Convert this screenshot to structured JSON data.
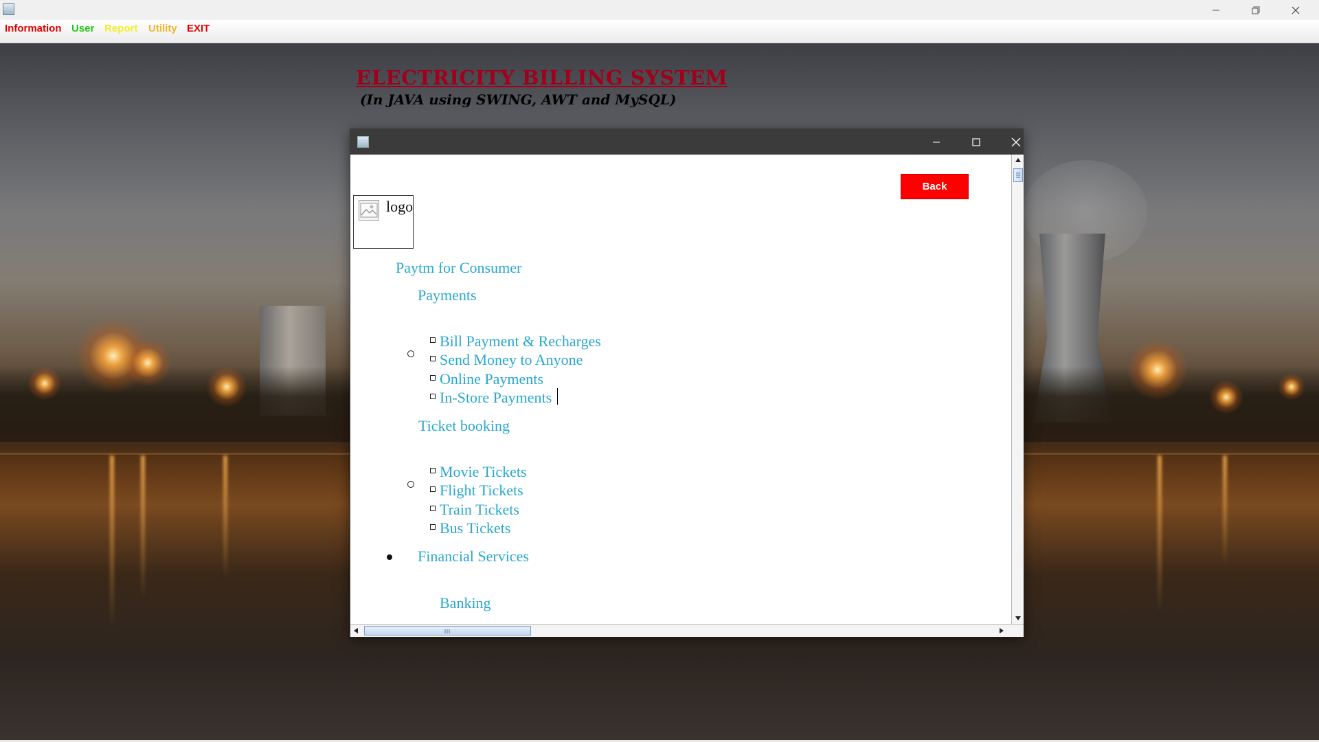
{
  "menubar": {
    "items": [
      {
        "label": "Information",
        "color": "#e00000"
      },
      {
        "label": "User",
        "color": "#22c418"
      },
      {
        "label": "Report",
        "color": "#f2ee2c"
      },
      {
        "label": "Utility",
        "color": "#f0b52a"
      },
      {
        "label": "EXIT",
        "color": "#e00000"
      }
    ]
  },
  "desktop": {
    "heading": "ELECTRICITY BILLING SYSTEM",
    "subheading": "(In JAVA using SWING, AWT and MySQL)"
  },
  "frame": {
    "back_label": "Back",
    "logo_alt": "logo",
    "content": {
      "section_title": "Paytm for Consumer",
      "payments": {
        "heading": "Payments",
        "items": [
          "Bill Payment & Recharges",
          "Send Money to Anyone",
          "Online Payments",
          "In-Store Payments"
        ]
      },
      "tickets": {
        "heading": "Ticket booking",
        "items": [
          "Movie Tickets",
          "Flight Tickets",
          "Train Tickets",
          "Bus Tickets"
        ]
      },
      "financial": {
        "heading": "Financial Services",
        "sub_heading": "Banking"
      }
    }
  },
  "colors": {
    "link_text": "#27a8cf",
    "back_button": "#ff0000",
    "heading": "#a0001c"
  },
  "icons": {
    "app": "java-cup-icon",
    "minimize": "minimize-icon",
    "maximize": "maximize-icon",
    "close": "close-icon"
  }
}
